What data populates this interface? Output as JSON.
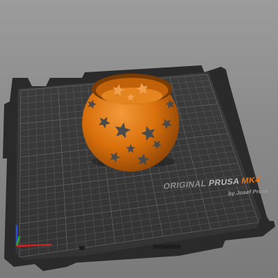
{
  "app": {
    "view": "3D plater viewport"
  },
  "bed": {
    "brand_original": "ORIGINAL",
    "brand_prusa": "PRUSA",
    "brand_model": "MK4",
    "brand_sub": "by Josef Prusa"
  },
  "object": {
    "shape": "star-cutout sphere vase",
    "color": "#e07a10"
  },
  "colors": {
    "background": "#8f8f8f",
    "bed_surface": "#3a3a3a",
    "grid_line": "#6e6e6e",
    "accent": "#e8730f",
    "axis_x": "#d32020",
    "axis_y": "#2ea82e",
    "axis_z": "#2a4fd8"
  },
  "icons": {
    "axes": "xyz-axes-gizmo-icon"
  }
}
